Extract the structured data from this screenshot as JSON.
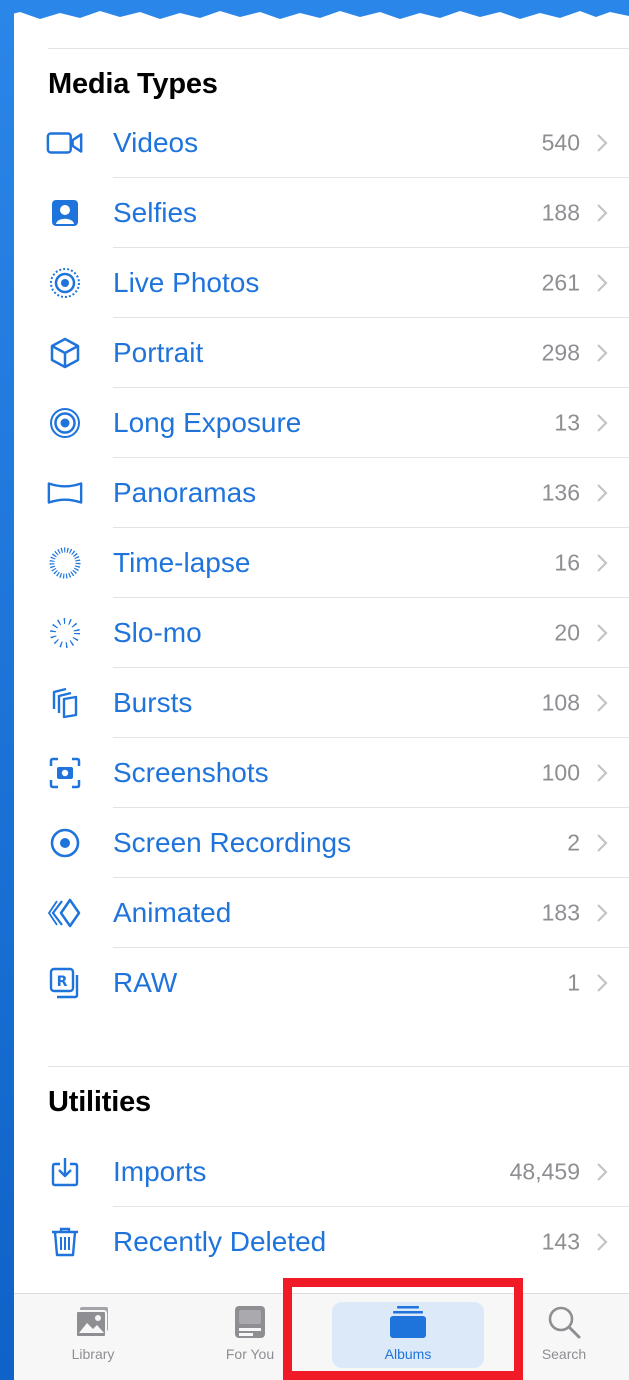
{
  "sections": [
    {
      "title": "Media Types",
      "items": [
        {
          "label": "Videos",
          "count": "540",
          "icon": "video-icon"
        },
        {
          "label": "Selfies",
          "count": "188",
          "icon": "selfie-icon"
        },
        {
          "label": "Live Photos",
          "count": "261",
          "icon": "live-photo-icon"
        },
        {
          "label": "Portrait",
          "count": "298",
          "icon": "cube-icon"
        },
        {
          "label": "Long Exposure",
          "count": "13",
          "icon": "long-exposure-icon"
        },
        {
          "label": "Panoramas",
          "count": "136",
          "icon": "panorama-icon"
        },
        {
          "label": "Time-lapse",
          "count": "16",
          "icon": "timelapse-icon"
        },
        {
          "label": "Slo-mo",
          "count": "20",
          "icon": "slomo-icon"
        },
        {
          "label": "Bursts",
          "count": "108",
          "icon": "bursts-icon"
        },
        {
          "label": "Screenshots",
          "count": "100",
          "icon": "screenshot-icon"
        },
        {
          "label": "Screen Recordings",
          "count": "2",
          "icon": "screen-recording-icon"
        },
        {
          "label": "Animated",
          "count": "183",
          "icon": "animated-icon"
        },
        {
          "label": "RAW",
          "count": "1",
          "icon": "raw-icon"
        }
      ]
    },
    {
      "title": "Utilities",
      "items": [
        {
          "label": "Imports",
          "count": "48,459",
          "icon": "import-icon"
        },
        {
          "label": "Recently Deleted",
          "count": "143",
          "icon": "trash-icon"
        }
      ]
    }
  ],
  "tabbar": {
    "tabs": [
      {
        "label": "Library",
        "icon": "library-icon",
        "active": false
      },
      {
        "label": "For You",
        "icon": "for-you-icon",
        "active": false
      },
      {
        "label": "Albums",
        "icon": "albums-icon",
        "active": true
      },
      {
        "label": "Search",
        "icon": "search-icon",
        "active": false
      }
    ]
  },
  "colors": {
    "accent": "#1f74dc",
    "highlight": "#f01b26",
    "background": "#1a73d6"
  }
}
